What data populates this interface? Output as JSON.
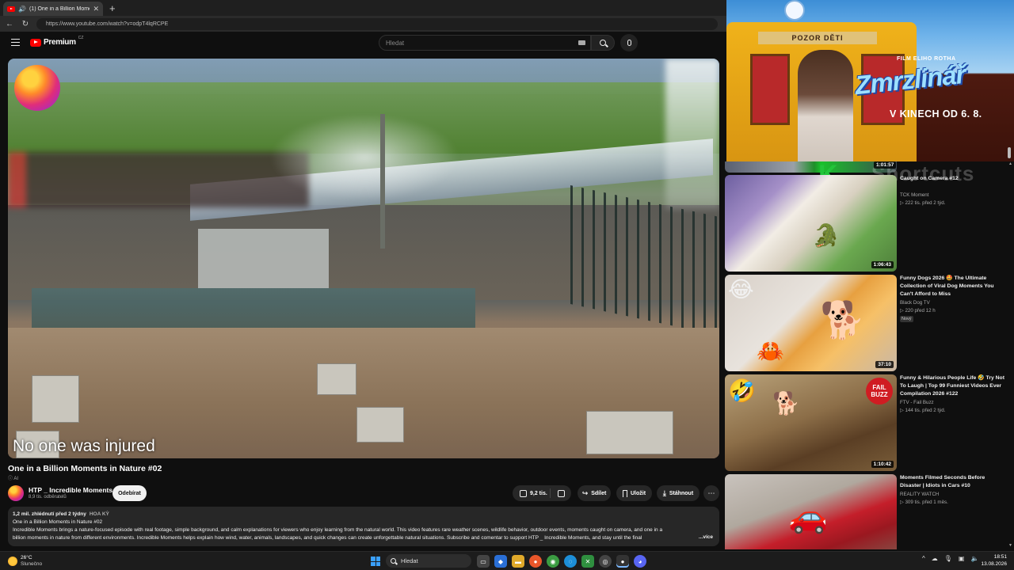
{
  "browser": {
    "tab_title": "(1) One in a Billion Moments i",
    "url": "https://www.youtube.com/watch?v=odpT4lqRCPE"
  },
  "header": {
    "brand": "Premium",
    "brand_suffix": "CZ",
    "search_placeholder": "Hledat"
  },
  "player": {
    "subtitle": "No one was injured"
  },
  "video": {
    "title": "One in a Billion Moments in Nature #02",
    "ai_label": "AI",
    "channel_name": "HTP _ Incredible Moments",
    "channel_subs": "8,9 tis. odběratelů",
    "subscribe_label": "Odebírat",
    "likes": "9,2 tis.",
    "share_label": "Sdílet",
    "save_label": "Uložit",
    "download_label": "Stáhnout",
    "more_label": "⋯"
  },
  "description": {
    "meta": "1,2 mil. zhlédnutí  před 2 týdny",
    "tag": "HOA KỲ",
    "line1": "One in a Billion Moments in Nature #02",
    "line2": "Incredible Moments brings a nature-focused episode with real footage, simple background, and calm explanations for viewers who enjoy learning from the natural world. This video features rare weather scenes, wildlife behavior, outdoor events, moments caught on camera, and one in a",
    "line3": "billion moments in nature from different environments. Incredible Moments helps explain how wind, water, animals, landscapes, and quick changes can create unforgettable natural situations. Subscribe and comentar to support HTP _ Incredible Moments, and stay until the final",
    "more": "...více"
  },
  "ad": {
    "bus_sign": "POZOR DĚTI",
    "film_credit": "FILM ELIHO ROTHA",
    "logo_text": "Zmrzlinář",
    "date_text": "V KINECH OD 6. 8."
  },
  "recommendations": {
    "partial": {
      "duration": "1:01:57",
      "title": "Caught on Camera #12",
      "title_overlay": "Shortcuts",
      "channel": "TCK Moment",
      "meta": "▷ 222 tis.  před 2 týd."
    },
    "items": [
      {
        "duration": "1:06:43",
        "title": "Funny Dogs 2026 🤩 The Ultimate Collection of Viral Dog Moments You Can't Afford to Miss",
        "channel": "Black Dog TV",
        "meta": "▷ 220  před 12 h",
        "badge": "Nový"
      },
      {
        "duration": "37:10",
        "title": "Funny & Hilarious People Life 🤣 Try Not To Laugh | Top 99 Funniest Videos Ever Compilation 2026 #122",
        "channel": "FTV - Fail Buzz",
        "meta": "▷ 144 tis.  před 2 týd."
      },
      {
        "duration": "1:10:42",
        "title": "Moments Filmed Seconds Before Disaster | Idiots in Cars #10",
        "channel": "REALITY WATCH",
        "meta": "▷ 309 tis.  před 1 měs."
      }
    ],
    "fail_badge": "FAIL BUZZ"
  },
  "taskbar": {
    "weather_temp": "26°C",
    "weather_desc": "Slunečno",
    "search_label": "Hledat",
    "time": "18:51",
    "date": "13.08.2026"
  }
}
